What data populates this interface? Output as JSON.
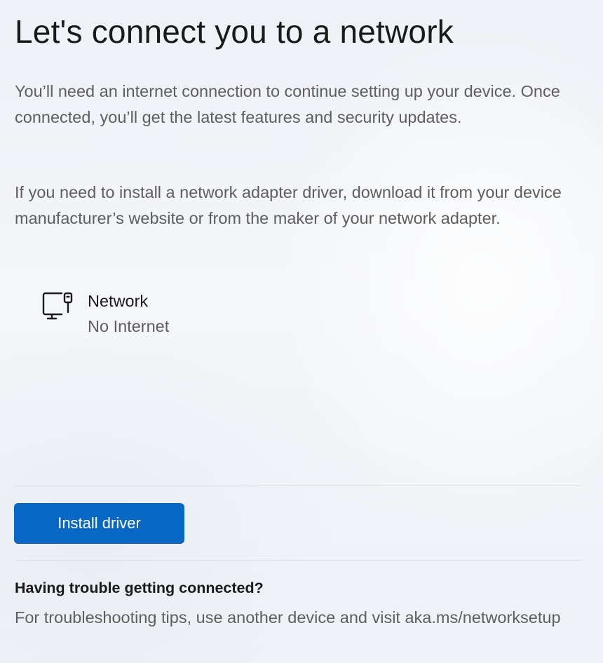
{
  "page": {
    "title": "Let's connect you to a network",
    "paragraph1": "You’ll need an internet connection to continue setting up your device. Once connected, you’ll get the latest features and security updates.",
    "paragraph2": "If you need to install a network adapter driver, download it from your device manufacturer’s website or from the maker of your network adapter."
  },
  "network": {
    "icon": "wired-network-computer-icon",
    "name": "Network",
    "status": "No Internet"
  },
  "actions": {
    "install_driver_label": "Install driver"
  },
  "help": {
    "heading": "Having trouble getting connected?",
    "text": "For troubleshooting tips, use another device and visit aka.ms/networksetup"
  },
  "colors": {
    "accent": "#0767c5",
    "background": "#f3f5f8",
    "primary_text": "#1b1b1b",
    "secondary_text": "#5e5e5e"
  }
}
